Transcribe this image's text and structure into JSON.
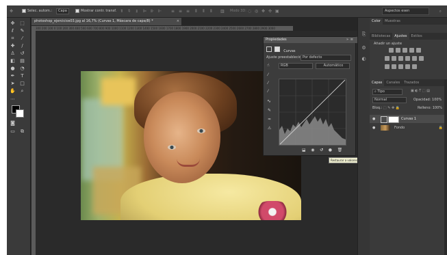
{
  "options_bar": {
    "move_icon": "move-tool-icon",
    "autoselect_label": "Selec. autom.:",
    "autoselect_value": "Capa",
    "transform_label": "Mostrar contr. transf.",
    "mode3d_label": "Modo 3D:",
    "workspace_value": "Aspectos esen"
  },
  "document": {
    "tab_title": "photoshop_ejercicios03.jpg al 16,7% (Curvas 1, Máscara de capa/8) *",
    "ruler_ticks": "300 200 100 0 100 200 300 400 500 600 700 800 900 1000 1100 1200 1300 1400 1500 1600 1700 1800 1900 2000 2100 2200 2300 2400 2500 2600 2700 2800 2900 3000"
  },
  "properties": {
    "panel_title": "Propiedades",
    "header_label": "Curvas",
    "preset_label": "Ajuste preestablecido:",
    "preset_value": "Por defecto",
    "channel_value": "RGB",
    "auto_button": "Automático",
    "tooltip": "Restaurar a valores por defecto de ajuste"
  },
  "right_panel": {
    "color_tabs": [
      "Color",
      "Muestras"
    ],
    "adjust_tabs": [
      "Bibliotecas",
      "Ajustes",
      "Estilos"
    ],
    "adjust_heading": "Añadir un ajuste",
    "layers_tabs": [
      "Capas",
      "Canales",
      "Trazados"
    ],
    "filter_kind": "Tipo",
    "blend_mode": "Normal",
    "opacity_label": "Opacidad:",
    "opacity_value": "100%",
    "lock_label": "Bloq.:",
    "fill_label": "Relleno:",
    "fill_value": "100%",
    "layers": [
      {
        "name": "Curvas 1"
      },
      {
        "name": "Fondo"
      }
    ]
  },
  "colors": {
    "accent": "#4a4a4a",
    "canvas": "#262626",
    "panel": "#3c3c3c"
  }
}
